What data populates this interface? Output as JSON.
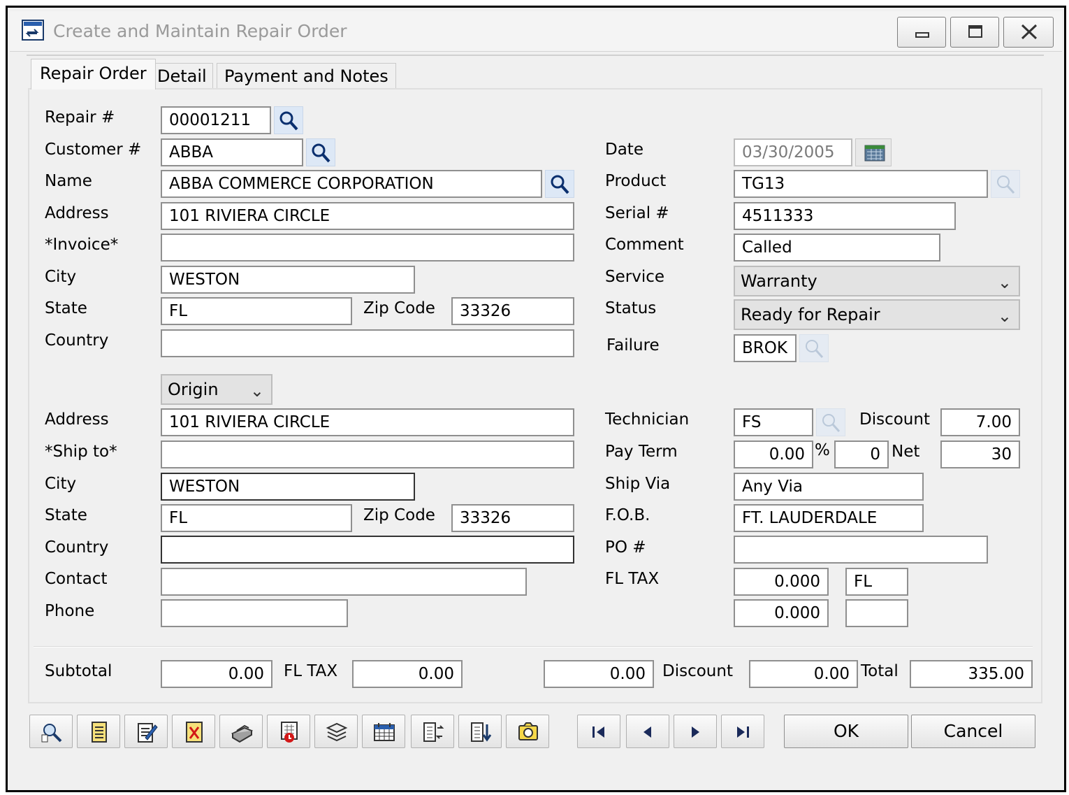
{
  "window": {
    "title": "Create and Maintain Repair Order"
  },
  "tabs": [
    "Repair Order",
    "Detail",
    "Payment and Notes"
  ],
  "customer": {
    "repair_label": "Repair #",
    "repair_value": "00001211",
    "customer_label": "Customer #",
    "customer_value": "ABBA",
    "name_label": "Name",
    "name_value": "ABBA COMMERCE CORPORATION",
    "address_label": "Address",
    "address_value": "101 RIVIERA CIRCLE",
    "invoice_label": "*Invoice*",
    "invoice_value": "",
    "city_label": "City",
    "city_value": "WESTON",
    "state_label": "State",
    "state_value": "FL",
    "zip_label": "Zip Code",
    "zip_value": "33326",
    "country_label": "Country",
    "country_value": ""
  },
  "ship": {
    "origin_select": "Origin",
    "address_label": "Address",
    "address_value": "101 RIVIERA CIRCLE",
    "shipto_label": "*Ship to*",
    "shipto_value": "",
    "city_label": "City",
    "city_value": "WESTON",
    "state_label": "State",
    "state_value": "FL",
    "zip_label": "Zip Code",
    "zip_value": "33326",
    "country_label": "Country",
    "country_value": "",
    "contact_label": "Contact",
    "contact_value": "",
    "phone_label": "Phone",
    "phone_value": ""
  },
  "order": {
    "date_label": "Date",
    "date_value": "03/30/2005",
    "product_label": "Product",
    "product_value": "TG13",
    "serial_label": "Serial #",
    "serial_value": "4511333",
    "comment_label": "Comment",
    "comment_value": "Called",
    "service_label": "Service",
    "service_value": "Warranty",
    "status_label": "Status",
    "status_value": "Ready for Repair",
    "failure_label": "Failure",
    "failure_value": "BROK",
    "technician_label": "Technician",
    "technician_value": "FS",
    "discount_label": "Discount",
    "discount_value": "7.00",
    "payterm_label": "Pay Term",
    "payterm_value": "0.00",
    "percent_sign": "%",
    "payterm_days": "0",
    "net_label": "Net",
    "net_value": "30",
    "shipvia_label": "Ship Via",
    "shipvia_value": "Any Via",
    "fob_label": "F.O.B.",
    "fob_value": "FT. LAUDERDALE",
    "po_label": "PO #",
    "po_value": "",
    "tax_label": "FL TAX",
    "tax1_rate": "0.000",
    "tax1_code": "FL",
    "tax2_rate": "0.000",
    "tax2_code": ""
  },
  "totals": {
    "subtotal_label": "Subtotal",
    "subtotal_value": "0.00",
    "tax_label": "FL TAX",
    "tax_value": "0.00",
    "tax2_value": "0.00",
    "discount_label": "Discount",
    "discount_value": "0.00",
    "total_label": "Total",
    "total_value": "335.00"
  },
  "buttons": {
    "ok": "OK",
    "cancel": "Cancel"
  },
  "toolbar_icons": [
    "find-icon",
    "document-icon",
    "edit-icon",
    "delete-icon",
    "print-icon",
    "calculator-icon",
    "stack-icon",
    "calendar-grid-icon",
    "transfer-icon",
    "sort-icon",
    "camera-icon"
  ],
  "nav_icons": [
    "first-record-icon",
    "previous-record-icon",
    "next-record-icon",
    "last-record-icon"
  ],
  "colors": {
    "search_button": "#dde8f6",
    "window_bg": "#f0f0f0",
    "title_text": "#9a9a9a"
  }
}
